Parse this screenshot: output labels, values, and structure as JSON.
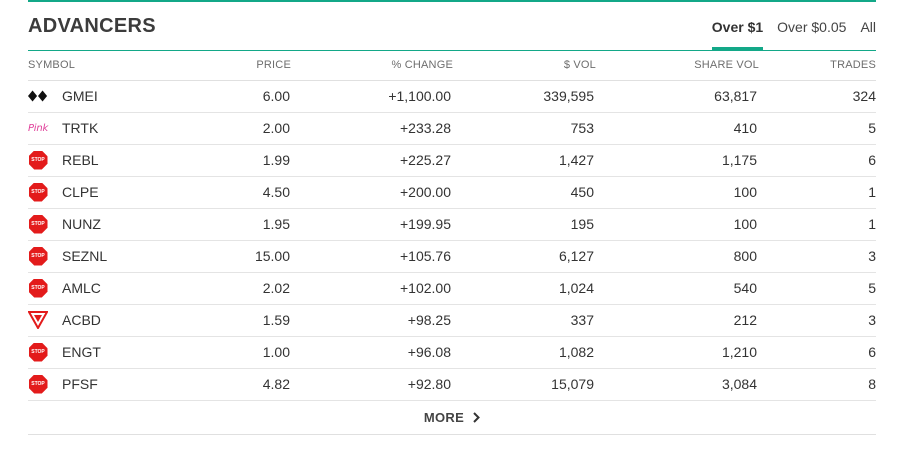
{
  "title": "ADVANCERS",
  "tabs": [
    {
      "label": "Over $1",
      "active": true
    },
    {
      "label": "Over $0.05",
      "active": false
    },
    {
      "label": "All",
      "active": false
    }
  ],
  "columns": {
    "symbol": "SYMBOL",
    "price": "PRICE",
    "change": "% CHANGE",
    "dollar_vol": "$ VOL",
    "share_vol": "SHARE VOL",
    "trades": "TRADES"
  },
  "rows": [
    {
      "icon": "diamond-icon",
      "symbol": "GMEI",
      "price": "6.00",
      "change": "+1,100.00",
      "dollar_vol": "339,595",
      "share_vol": "63,817",
      "trades": "324"
    },
    {
      "icon": "pink-tier-icon",
      "icon_text": "Pink",
      "symbol": "TRTK",
      "price": "2.00",
      "change": "+233.28",
      "dollar_vol": "753",
      "share_vol": "410",
      "trades": "5"
    },
    {
      "icon": "stop-sign-icon",
      "icon_text": "STOP",
      "symbol": "REBL",
      "price": "1.99",
      "change": "+225.27",
      "dollar_vol": "1,427",
      "share_vol": "1,175",
      "trades": "6"
    },
    {
      "icon": "stop-sign-icon",
      "icon_text": "STOP",
      "symbol": "CLPE",
      "price": "4.50",
      "change": "+200.00",
      "dollar_vol": "450",
      "share_vol": "100",
      "trades": "1"
    },
    {
      "icon": "stop-sign-icon",
      "icon_text": "STOP",
      "symbol": "NUNZ",
      "price": "1.95",
      "change": "+199.95",
      "dollar_vol": "195",
      "share_vol": "100",
      "trades": "1"
    },
    {
      "icon": "stop-sign-icon",
      "icon_text": "STOP",
      "symbol": "SEZNL",
      "price": "15.00",
      "change": "+105.76",
      "dollar_vol": "6,127",
      "share_vol": "800",
      "trades": "3"
    },
    {
      "icon": "stop-sign-icon",
      "icon_text": "STOP",
      "symbol": "AMLC",
      "price": "2.02",
      "change": "+102.00",
      "dollar_vol": "1,024",
      "share_vol": "540",
      "trades": "5"
    },
    {
      "icon": "caveat-emptor-icon",
      "symbol": "ACBD",
      "price": "1.59",
      "change": "+98.25",
      "dollar_vol": "337",
      "share_vol": "212",
      "trades": "3"
    },
    {
      "icon": "stop-sign-icon",
      "icon_text": "STOP",
      "symbol": "ENGT",
      "price": "1.00",
      "change": "+96.08",
      "dollar_vol": "1,082",
      "share_vol": "1,210",
      "trades": "6"
    },
    {
      "icon": "stop-sign-icon",
      "icon_text": "STOP",
      "symbol": "PFSF",
      "price": "4.82",
      "change": "+92.80",
      "dollar_vol": "15,079",
      "share_vol": "3,084",
      "trades": "8"
    }
  ],
  "more_label": "MORE",
  "colors": {
    "accent": "#13a888",
    "stop_red": "#e31b1b",
    "pink": "#e0409a"
  }
}
